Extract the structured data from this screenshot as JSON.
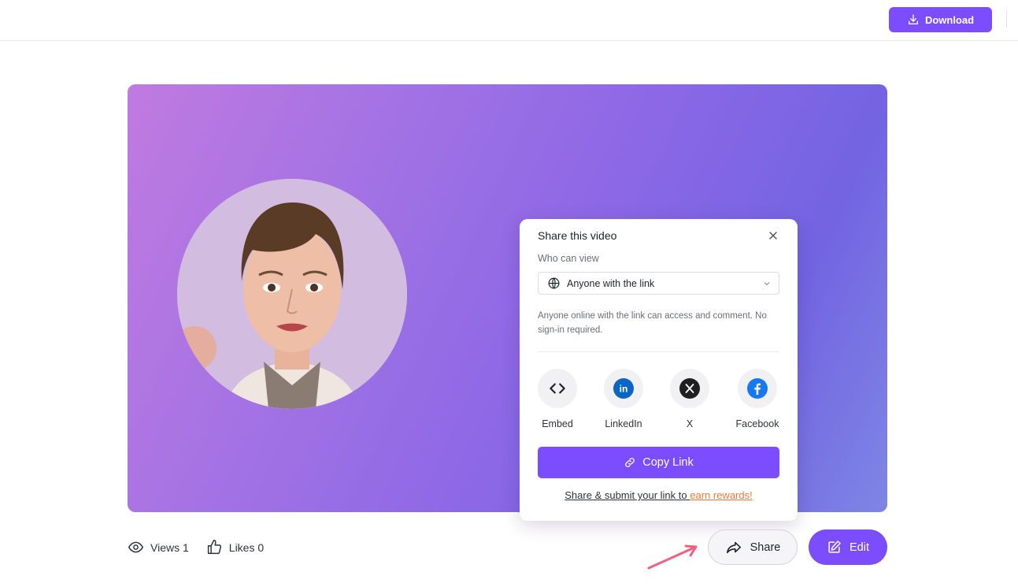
{
  "header": {
    "download_label": "Download",
    "download_icon": "download-icon"
  },
  "video": {
    "avatar": "presenter-avatar",
    "gradient_colors": [
      "#c07ae0",
      "#8d68e6",
      "#7364e2"
    ]
  },
  "share_popup": {
    "title": "Share this video",
    "who_can_view_label": "Who can view",
    "access_selected": "Anyone with the link",
    "access_description": "Anyone online with the link can access and comment. No sign-in required.",
    "options": [
      {
        "label": "Embed",
        "icon": "code-icon"
      },
      {
        "label": "LinkedIn",
        "icon": "linkedin-icon",
        "color": "#0a66c2"
      },
      {
        "label": "X",
        "icon": "x-icon",
        "color": "#1f1f1f"
      },
      {
        "label": "Facebook",
        "icon": "facebook-icon",
        "color": "#1877f2"
      }
    ],
    "copy_link_label": "Copy Link",
    "rewards_text": "Share & submit your link to ",
    "rewards_link": "earn rewards!"
  },
  "stats": {
    "views_label": "Views 1",
    "likes_label": "Likes 0"
  },
  "actions": {
    "share_label": "Share",
    "edit_label": "Edit"
  },
  "colors": {
    "accent": "#7b4dff",
    "rewards_link": "#f07a3c",
    "pointer_arrow": "#f2607e"
  }
}
